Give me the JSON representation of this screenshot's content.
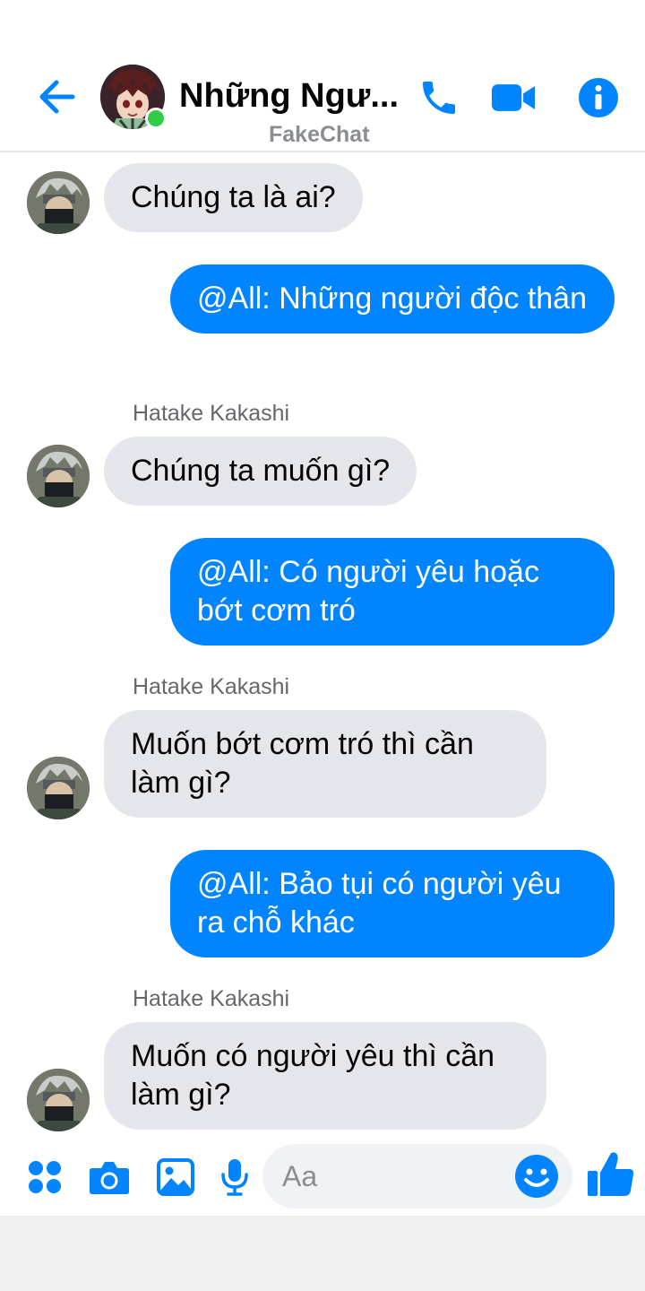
{
  "header": {
    "title": "Những Ngư...",
    "subtitle": "FakeChat",
    "icons": [
      "back-arrow-icon",
      "phone-icon",
      "video-camera-icon",
      "info-icon"
    ],
    "online": true
  },
  "messages": [
    {
      "side": "in",
      "sender": "",
      "text": "Chúng ta là ai?"
    },
    {
      "side": "out",
      "text": "@All: Những người độc thân"
    },
    {
      "side": "in",
      "sender": "Hatake Kakashi",
      "text": "Chúng ta muốn gì?"
    },
    {
      "side": "out",
      "text": "@All: Có người yêu hoặc bớt cơm tró"
    },
    {
      "side": "in",
      "sender": "Hatake Kakashi",
      "text": "Muốn bớt cơm tró thì cần làm gì?"
    },
    {
      "side": "out",
      "text": "@All: Bảo tụi có người yêu ra chỗ khác"
    },
    {
      "side": "in",
      "sender": "Hatake Kakashi",
      "text": "Muốn có người yêu thì cần làm gì?"
    }
  ],
  "composer": {
    "placeholder": "Aa",
    "icons": [
      "apps-grid-icon",
      "camera-icon",
      "image-icon",
      "microphone-icon",
      "emoji-icon",
      "thumbs-up-icon"
    ]
  },
  "colors": {
    "accent": "#0084ff",
    "incoming_bubble": "#e4e6eb",
    "online": "#31cc46"
  }
}
